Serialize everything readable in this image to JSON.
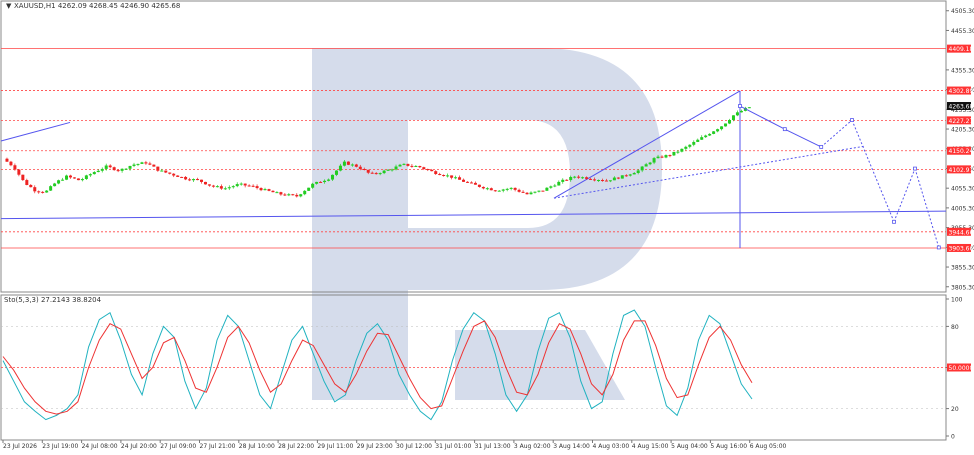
{
  "header": {
    "symbol_line": "XAUUSD,H1  4262.09 4268.45 4246.90 4265.68",
    "osc_line": "Sto(5,3,3) 27.2143 38.8204"
  },
  "colors": {
    "bull": "#22cc22",
    "bear": "#ee2222",
    "level_line": "#ff4444",
    "price_badge": "#ff3333",
    "current_badge": "#111111",
    "forecast": "#5555ee",
    "stoch_main": "#20b2c0",
    "stoch_signal": "#ee3333",
    "watermark": "#d5dceb"
  },
  "chart_data": [
    {
      "type": "candlestick",
      "title": "XAUUSD,H1",
      "ohlc_last": {
        "open": 4262.09,
        "high": 4268.45,
        "low": 4246.9,
        "close": 4265.68
      },
      "y_ticks": [
        4505.3,
        4455.3,
        4355.3,
        4305.3,
        4255.3,
        4205.3,
        4155.3,
        4105.3,
        4055.3,
        4005.3,
        3955.3,
        3905.3,
        3855.3,
        3805.3
      ],
      "ylim": [
        3792,
        4530
      ],
      "x_labels": [
        "23 Jul 2026",
        "23 Jul 19:00",
        "24 Jul 08:00",
        "24 Jul 20:00",
        "27 Jul 09:00",
        "27 Jul 21:00",
        "28 Jul 10:00",
        "28 Jul 22:00",
        "29 Jul 11:00",
        "29 Jul 23:00",
        "30 Jul 12:00",
        "31 Jul 01:00",
        "31 Jul 13:00",
        "3 Aug 02:00",
        "3 Aug 14:00",
        "4 Aug 03:00",
        "4 Aug 15:00",
        "5 Aug 04:00",
        "5 Aug 16:00",
        "6 Aug 05:00"
      ],
      "levels": [
        {
          "label": "4409.18",
          "value": 4409.18
        },
        {
          "label": "4302.89",
          "value": 4302.89
        },
        {
          "label": "4227.27",
          "value": 4227.27
        },
        {
          "label": "4150.24",
          "value": 4150.24
        },
        {
          "label": "4102.97",
          "value": 4102.97
        },
        {
          "label": "3944.66",
          "value": 3944.66
        },
        {
          "label": "3903.66",
          "value": 3903.66
        }
      ],
      "current_price": {
        "label": "4263.68",
        "value": 4263.68
      },
      "close_path": [
        [
          0,
          4130
        ],
        [
          8,
          4110
        ],
        [
          16,
          4070
        ],
        [
          24,
          4050
        ],
        [
          32,
          4045
        ],
        [
          40,
          4070
        ],
        [
          48,
          4085
        ],
        [
          58,
          4075
        ],
        [
          68,
          4095
        ],
        [
          78,
          4110
        ],
        [
          88,
          4100
        ],
        [
          98,
          4115
        ],
        [
          108,
          4120
        ],
        [
          118,
          4100
        ],
        [
          128,
          4090
        ],
        [
          138,
          4080
        ],
        [
          148,
          4075
        ],
        [
          158,
          4060
        ],
        [
          168,
          4055
        ],
        [
          178,
          4065
        ],
        [
          188,
          4060
        ],
        [
          198,
          4050
        ],
        [
          210,
          4040
        ],
        [
          222,
          4035
        ],
        [
          234,
          4065
        ],
        [
          246,
          4080
        ],
        [
          258,
          4120
        ],
        [
          268,
          4110
        ],
        [
          278,
          4090
        ],
        [
          290,
          4100
        ],
        [
          302,
          4115
        ],
        [
          314,
          4110
        ],
        [
          326,
          4095
        ],
        [
          338,
          4085
        ],
        [
          350,
          4070
        ],
        [
          360,
          4060
        ],
        [
          372,
          4050
        ],
        [
          384,
          4055
        ],
        [
          396,
          4040
        ],
        [
          408,
          4050
        ],
        [
          420,
          4070
        ],
        [
          432,
          4085
        ],
        [
          444,
          4080
        ],
        [
          456,
          4075
        ],
        [
          468,
          4085
        ],
        [
          480,
          4100
        ],
        [
          492,
          4130
        ],
        [
          504,
          4140
        ],
        [
          514,
          4155
        ],
        [
          524,
          4175
        ],
        [
          534,
          4195
        ],
        [
          544,
          4215
        ],
        [
          552,
          4240
        ],
        [
          560,
          4255
        ],
        [
          566,
          4263.68
        ]
      ],
      "forecast_path": [
        {
          "x": 4.3,
          "y": 4263.68
        },
        {
          "x": 4.62,
          "y": 4205
        },
        {
          "x": 4.88,
          "y": 4160
        },
        {
          "x": 5.1,
          "y": 4228
        },
        {
          "x": 5.4,
          "y": 3970
        },
        {
          "x": 5.55,
          "y": 4105
        },
        {
          "x": 5.72,
          "y": 3905
        }
      ]
    },
    {
      "type": "line",
      "title": "Sto(5,3,3)",
      "y_ticks": [
        100,
        80,
        50,
        20,
        0
      ],
      "ylim": [
        0,
        100
      ],
      "levels": [
        {
          "label": "50.0000",
          "value": 50
        }
      ],
      "main_value": 27.2143,
      "signal_value": 38.8204,
      "series": [
        {
          "name": "Sto(5,3,3) main",
          "values": [
            55,
            40,
            25,
            18,
            12,
            15,
            20,
            30,
            65,
            85,
            90,
            70,
            45,
            30,
            60,
            80,
            72,
            40,
            20,
            35,
            70,
            88,
            80,
            55,
            30,
            20,
            45,
            70,
            80,
            60,
            40,
            25,
            30,
            55,
            75,
            82,
            70,
            45,
            30,
            18,
            12,
            25,
            55,
            78,
            90,
            84,
            60,
            30,
            18,
            30,
            62,
            86,
            90,
            72,
            40,
            20,
            25,
            60,
            88,
            92,
            80,
            50,
            22,
            15,
            35,
            70,
            88,
            82,
            60,
            38,
            27
          ]
        },
        {
          "name": "Sto(5,3,3) signal",
          "values": [
            58,
            48,
            35,
            25,
            18,
            16,
            18,
            25,
            50,
            70,
            82,
            78,
            60,
            42,
            50,
            68,
            72,
            55,
            35,
            32,
            50,
            72,
            80,
            68,
            48,
            32,
            38,
            55,
            70,
            66,
            52,
            38,
            32,
            45,
            62,
            75,
            74,
            58,
            42,
            28,
            20,
            22,
            42,
            62,
            80,
            84,
            72,
            50,
            32,
            30,
            45,
            68,
            82,
            78,
            60,
            38,
            30,
            45,
            70,
            84,
            84,
            66,
            42,
            28,
            30,
            52,
            72,
            80,
            70,
            52,
            38.82
          ]
        }
      ]
    }
  ]
}
